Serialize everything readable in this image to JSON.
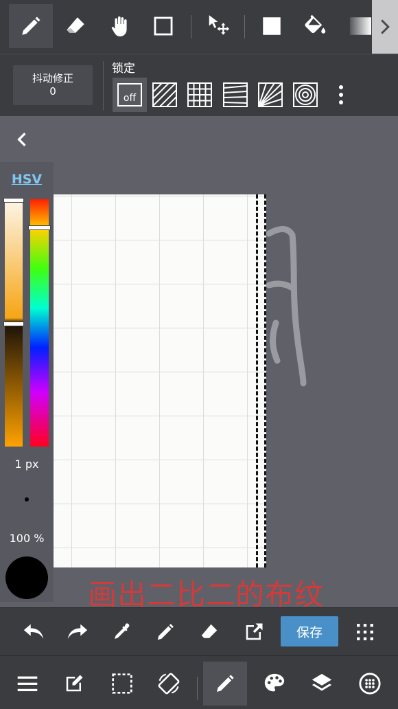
{
  "top_toolbar": {
    "tools": [
      "pen-tool",
      "eraser-tool",
      "hand-tool",
      "rectangle-tool",
      "move-tool",
      "fill-rect-tool",
      "bucket-tool",
      "gradient-tool"
    ],
    "active_tool": "pen-tool"
  },
  "sub_toolbar": {
    "stabilizer_label": "抖动修正",
    "stabilizer_value": "0",
    "lock_label": "锁定",
    "off_label": "off",
    "rulers": [
      "off",
      "parallel",
      "grid",
      "perspective-lines",
      "radial",
      "concentric"
    ]
  },
  "color_panel": {
    "mode_label": "HSV",
    "brush_size": "1 px",
    "opacity": "100 %",
    "current_color": "#000000"
  },
  "caption": "画出二比二的布纹",
  "action_bar": {
    "save_label": "保存"
  },
  "colors": {
    "toolbar_bg": "#3b3c40",
    "workspace_bg": "#5f6068",
    "save_button": "#4a90c8",
    "caption_text": "#d23b3b",
    "hsv_link": "#7fc6f0"
  }
}
